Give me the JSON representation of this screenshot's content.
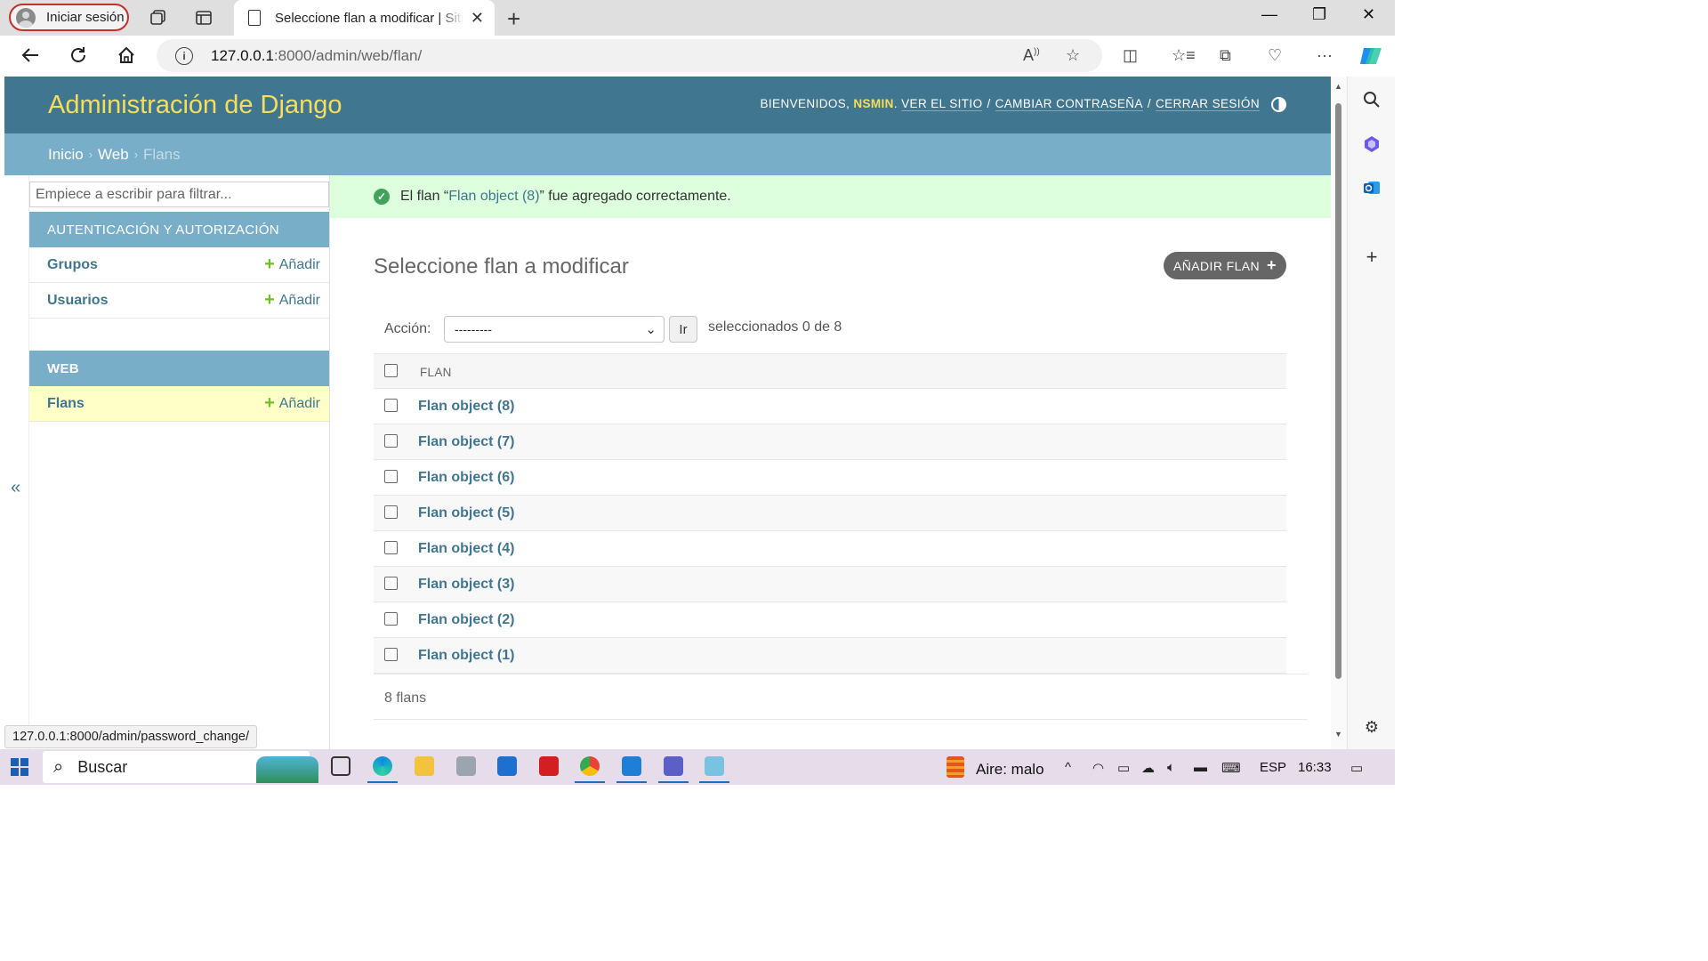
{
  "browser": {
    "profile_label": "Iniciar sesión",
    "tab_title": "Seleccione flan a modificar | Sitio de administración de Django",
    "url_host": "127.0.0.1",
    "url_rest": ":8000/admin/web/flan/",
    "status_url": "127.0.0.1:8000/admin/password_change/"
  },
  "header": {
    "branding": "Administración de Django",
    "welcome": "BIENVENIDOS,",
    "username": "NSMIN",
    "view_site": "VER EL SITIO",
    "change_password": "CAMBIAR CONTRASEÑA",
    "logout": "CERRAR SESIÓN",
    "separator": "/"
  },
  "breadcrumbs": {
    "home": "Inicio",
    "app": "Web",
    "current": "Flans",
    "sep": "›"
  },
  "sidebar": {
    "filter_placeholder": "Empiece a escribir para filtrar...",
    "collapse_label": "«",
    "add_label": "Añadir",
    "apps": [
      {
        "caption": "AUTENTICACIÓN Y AUTORIZACIÓN",
        "models": [
          "Grupos",
          "Usuarios"
        ]
      },
      {
        "caption": "WEB",
        "models": [
          "Flans"
        ]
      }
    ]
  },
  "message": {
    "prefix": "El flan “",
    "link": "Flan object (8)",
    "suffix": "” fue agregado correctamente."
  },
  "content": {
    "title": "Seleccione flan a modificar",
    "add_button": "AÑADIR FLAN",
    "action_label": "Acción:",
    "action_selected": "---------",
    "go_button": "Ir",
    "counter": "seleccionados 0 de 8",
    "column_header": "FLAN",
    "rows": [
      "Flan object (8)",
      "Flan object (7)",
      "Flan object (6)",
      "Flan object (5)",
      "Flan object (4)",
      "Flan object (3)",
      "Flan object (2)",
      "Flan object (1)"
    ],
    "paginator": "8 flans"
  },
  "taskbar": {
    "search": "Buscar",
    "weather": "Aire: malo",
    "language": "ESP",
    "time": "16:33"
  },
  "colors": {
    "header_bg": "#417690",
    "branding": "#f5dd5d",
    "breadcrumbs_bg": "#79aec8",
    "link": "#417690",
    "success_bg": "#ddffdd",
    "current_model_bg": "#ffffc8",
    "add_green": "#70bf2b"
  }
}
